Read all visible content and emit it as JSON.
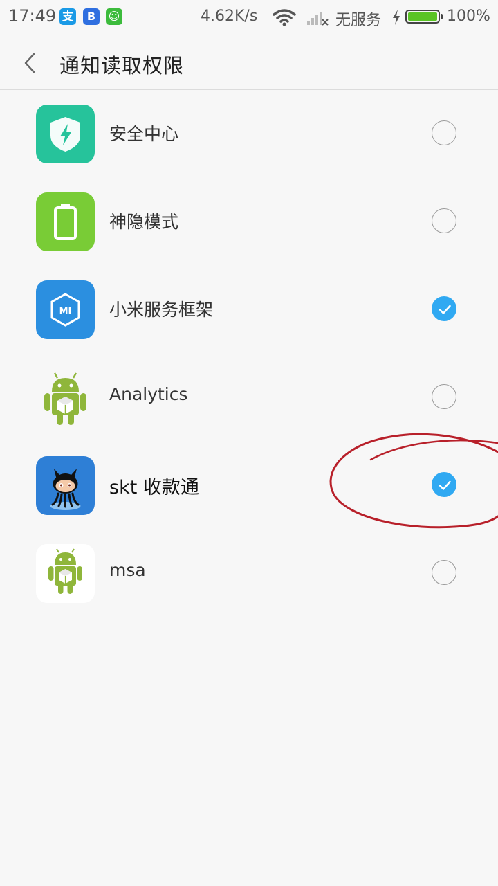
{
  "status_bar": {
    "time": "17:49",
    "app_icons": [
      {
        "icon": "alipay-icon",
        "glyph": "支",
        "color": "#1a9ae6"
      },
      {
        "icon": "baidu-icon",
        "glyph": "B",
        "color": "#2f6fe0"
      },
      {
        "icon": "wechat-icon",
        "glyph": "☺",
        "color": "#3cbb3c"
      }
    ],
    "net_speed": "4.62K/s",
    "carrier": "无服务",
    "battery_percent": "100%",
    "battery_level": 1.0
  },
  "header": {
    "title": "通知读取权限"
  },
  "apps": [
    {
      "label": "安全中心",
      "icon": "security-center-icon",
      "checked": false
    },
    {
      "label": "神隐模式",
      "icon": "battery-saver-icon",
      "checked": false
    },
    {
      "label": "小米服务框架",
      "icon": "mi-service-framework-icon",
      "checked": true
    },
    {
      "label": "Analytics",
      "icon": "android-icon",
      "checked": false
    },
    {
      "label": "skt 收款通",
      "icon": "octocat-icon",
      "checked": true
    },
    {
      "label": "msa",
      "icon": "android-icon",
      "checked": false
    }
  ],
  "colors": {
    "checked": "#30a9f2",
    "annotation": "#b8202a"
  }
}
